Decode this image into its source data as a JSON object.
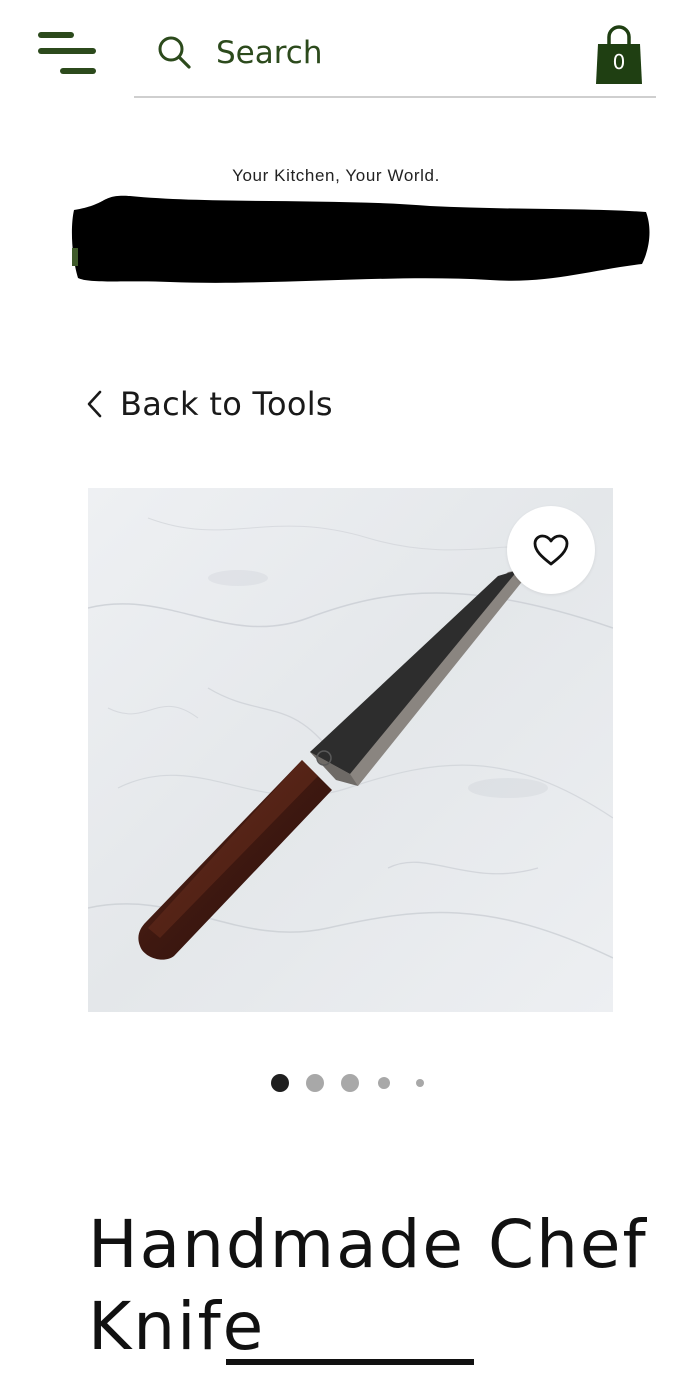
{
  "header": {
    "menu_icon": "menu-icon",
    "search": {
      "placeholder": "Search",
      "value": "",
      "icon": "search-icon"
    },
    "cart": {
      "icon": "shopping-bag-icon",
      "count": "0"
    }
  },
  "brand": {
    "tagline": "Your Kitchen, Your World.",
    "name_redacted": true
  },
  "nav": {
    "back_label": "Back to Tools",
    "back_icon": "chevron-left-icon"
  },
  "product": {
    "image_alt": "Handmade Chef Knife",
    "wishlist_icon": "heart-icon",
    "title": "Handmade Chef Knife",
    "gallery": {
      "total": 5,
      "active_index": 0
    }
  },
  "colors": {
    "brand_green": "#2c4a1c",
    "text_dark": "#1a1a1a",
    "dot_active": "#1f1f1f",
    "dot_inactive": "#a8a8a8"
  }
}
